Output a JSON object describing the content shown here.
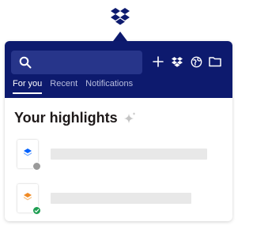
{
  "header": {
    "search": {
      "placeholder": ""
    },
    "tabs": [
      {
        "label": "For you",
        "active": true
      },
      {
        "label": "Recent",
        "active": false
      },
      {
        "label": "Notifications",
        "active": false
      }
    ],
    "toolbar_icons": [
      "plus-icon",
      "dropbox-icon",
      "globe-icon",
      "folder-icon"
    ]
  },
  "main": {
    "title": "Your highlights",
    "title_icon": "sparkle-icon",
    "items": [
      {
        "file_icon": "blue-cube-icon",
        "file_color": "#0061fe",
        "status_icon": "sync-status-icon",
        "status_color": "#9a9a9a"
      },
      {
        "file_icon": "orange-cube-icon",
        "file_color": "#f08a24",
        "status_icon": "check-status-icon",
        "status_color": "#1e9e52"
      }
    ]
  },
  "colors": {
    "header_bg": "#0d1a6e",
    "search_bg": "#27358a",
    "brand_blue": "#0d1a6e",
    "placeholder_bar": "#e8e8e8"
  }
}
